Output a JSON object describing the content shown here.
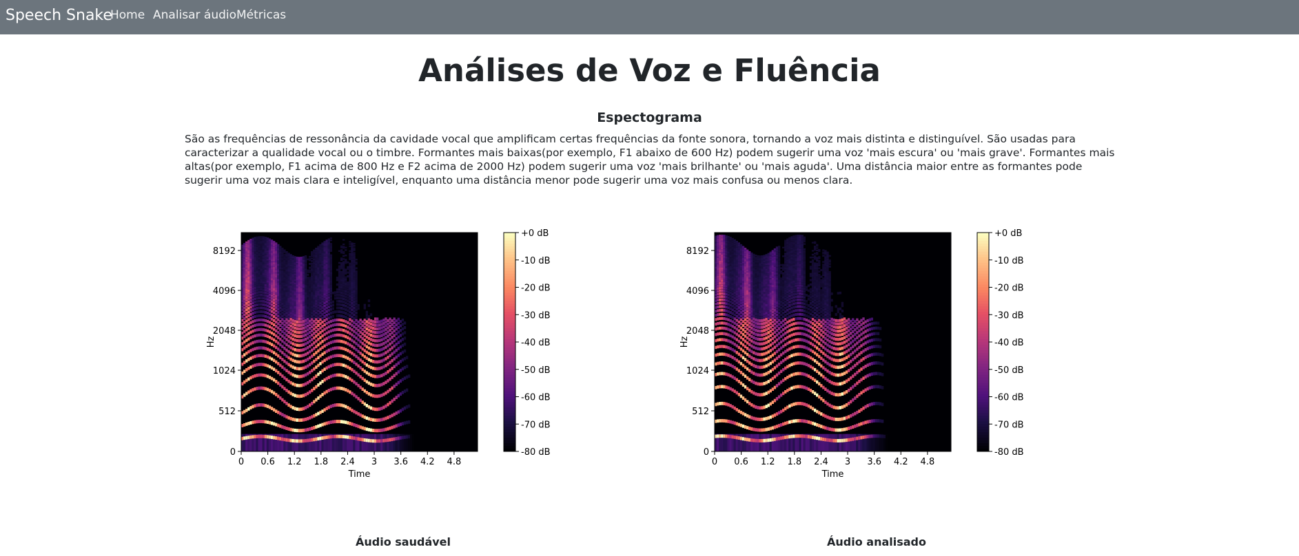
{
  "navbar": {
    "brand": "Speech Snake",
    "links": [
      "Home",
      "Analisar áudio",
      "Métricas"
    ]
  },
  "page_title": "Análises de Voz e Fluência",
  "section": {
    "title": "Espectograma",
    "description": "São as frequências de ressonância da cavidade vocal que amplificam certas frequências da fonte sonora, tornando a voz mais distinta e distinguível. São usadas para caracterizar a qualidade vocal ou o timbre. Formantes mais baixas(por exemplo, F1 abaixo de 600 Hz) podem sugerir uma voz 'mais escura' ou 'mais grave'. Formantes mais altas(por exemplo, F1 acima de 800 Hz e F2 acima de 2000 Hz) podem sugerir uma voz 'mais brilhante' ou 'mais aguda'. Uma distância maior entre as formantes pode sugerir uma voz mais clara e inteligível, enquanto uma distância menor pode sugerir uma voz mais confusa ou menos clara."
  },
  "colors": {
    "navbar_bg": "#6c757d",
    "spectrogram_bg": "#000004"
  },
  "chart_data": [
    {
      "type": "heatmap",
      "caption": "Áudio saudável",
      "xlabel": "Time",
      "ylabel": "Hz",
      "x_ticks": [
        "0",
        "0.6",
        "1.2",
        "1.8",
        "2.4",
        "3",
        "3.6",
        "4.2",
        "4.8"
      ],
      "y_ticks": [
        "0",
        "512",
        "1024",
        "2048",
        "4096",
        "8192"
      ],
      "y_scale": "log",
      "colorbar_ticks": [
        "+0 dB",
        "-10 dB",
        "-20 dB",
        "-30 dB",
        "-40 dB",
        "-50 dB",
        "-60 dB",
        "-70 dB",
        "-80 dB"
      ],
      "colorbar_range": [
        -80,
        0
      ],
      "colormap": "magma"
    },
    {
      "type": "heatmap",
      "caption": "Áudio analisado",
      "xlabel": "Time",
      "ylabel": "Hz",
      "x_ticks": [
        "0",
        "0.6",
        "1.2",
        "1.8",
        "2.4",
        "3",
        "3.6",
        "4.2",
        "4.8"
      ],
      "y_ticks": [
        "0",
        "512",
        "1024",
        "2048",
        "4096",
        "8192"
      ],
      "y_scale": "log",
      "colorbar_ticks": [
        "+0 dB",
        "-10 dB",
        "-20 dB",
        "-30 dB",
        "-40 dB",
        "-50 dB",
        "-60 dB",
        "-70 dB",
        "-80 dB"
      ],
      "colorbar_range": [
        -80,
        0
      ],
      "colormap": "magma"
    }
  ]
}
